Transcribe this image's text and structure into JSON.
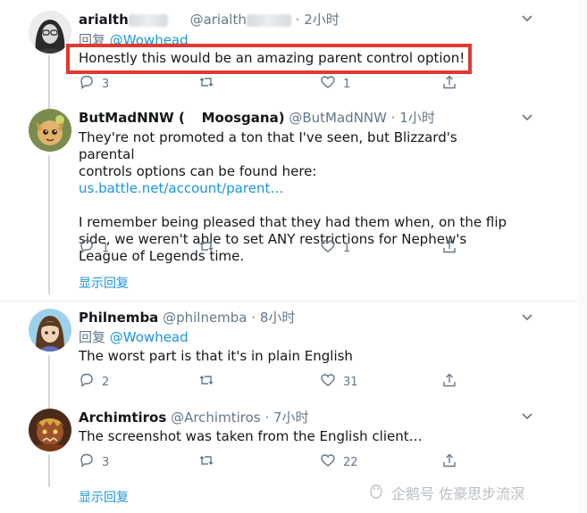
{
  "tweets": [
    {
      "name": "arialth",
      "handle": "@arialth",
      "sep": "·",
      "time": "2小时",
      "reply_label": "回复",
      "reply_mention": "@Wowhead",
      "text": "Honestly this would be an amazing parent control option!",
      "replies": "3",
      "retweets": "",
      "likes": "1"
    },
    {
      "name": "ButMadNNW (",
      "name2": "Moosgana)",
      "handle": "@ButMadNNW",
      "sep": "·",
      "time": "1小时",
      "text_line1": "They're not promoted a ton that I've seen, but Blizzard's parental",
      "text_line2_prefix": "controls options can be found here: ",
      "link": "us.battle.net/account/parent…",
      "text_para2": "I remember being pleased that they had them when, on the flip side, we weren't able to set ANY restrictions for Nephew's League of Legends time.",
      "replies": "1",
      "retweets": "",
      "likes": "1",
      "show_replies": "显示回复"
    },
    {
      "name": "Philnemba",
      "handle": "@philnemba",
      "sep": "·",
      "time": "8小时",
      "reply_label": "回复",
      "reply_mention": "@Wowhead",
      "text": "The worst part is that it's in plain English",
      "replies": "2",
      "retweets": "",
      "likes": "31"
    },
    {
      "name": "Archimtiros",
      "handle": "@Archimtiros",
      "sep": "·",
      "time": "7小时",
      "text": "The screenshot was taken from the English client…",
      "replies": "3",
      "retweets": "",
      "likes": "22",
      "show_replies": "显示回复"
    }
  ],
  "watermark": "企鹅号 佐豪思步流溟",
  "colors": {
    "link": "#1b95e0",
    "muted": "#657786",
    "highlight": "#e0392f"
  }
}
